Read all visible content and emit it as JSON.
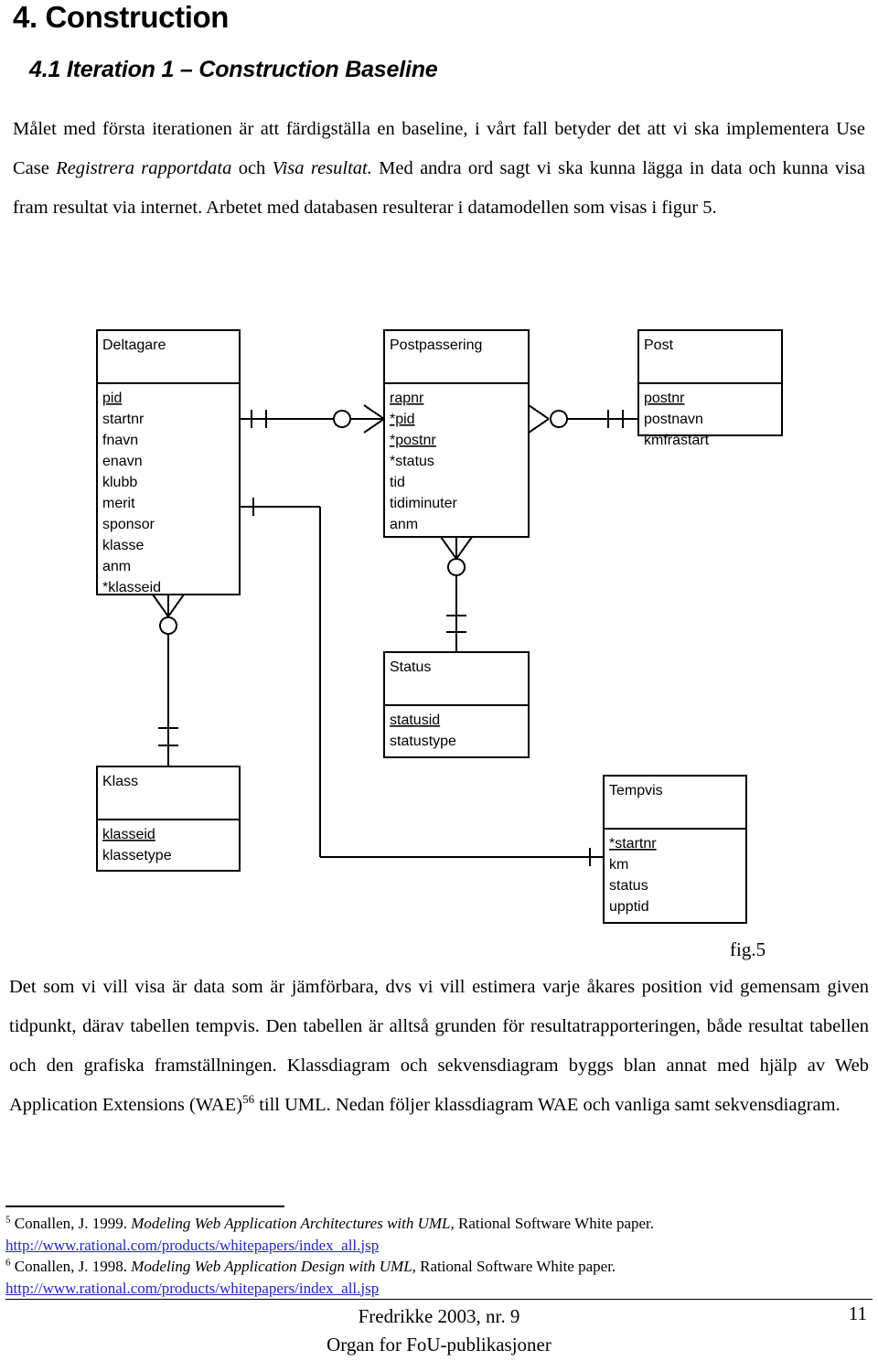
{
  "document": {
    "heading1": "4. Construction",
    "heading2": "4.1 Iteration 1 – Construction Baseline",
    "intro_paragraph": {
      "seg1": "Målet med första iterationen är att färdigställa en baseline, i vårt fall betyder det att vi ska implementera Use Case ",
      "em1": "Registrera rapportdata",
      "seg2": " och ",
      "em2": "Visa resultat.",
      "seg3": " Med andra ord sagt vi ska kunna lägga in data och kunna visa fram resultat via internet. Arbetet med databasen resulterar i  datamodellen som visas i figur 5."
    },
    "figure_caption": "fig.5",
    "body_paragraph": {
      "seg1": "Det som vi vill visa är data som är jämförbara, dvs vi vill estimera varje åkares position vid gemensam given tidpunkt, därav tabellen tempvis. Den tabellen är alltså grunden för resultatrapporteringen, både resultat tabellen och den grafiska framställningen.  Klassdiagram och sekvensdiagram byggs blan annat med hjälp av Web Application Extensions (WAE)",
      "footnote_refs": "56",
      "seg2": " till UML. Nedan följer klassdiagram WAE och vanliga samt sekvensdiagram."
    },
    "footnotes": [
      {
        "marker": "5",
        "seg1": " Conallen, J. 1999. ",
        "em": "Modeling Web Application Architectures  with UML,",
        "seg2": "  Rational Software White paper.",
        "url": "http://www.rational.com/products/whitepapers/index_all.jsp"
      },
      {
        "marker": "6",
        "seg1": " Conallen, J. 1998. ",
        "em": "Modeling Web Application Design with UML,",
        "seg2": "  Rational Software White paper.",
        "url": "http://www.rational.com/products/whitepapers/index_all.jsp"
      }
    ],
    "footer": {
      "line1": "Fredrikke 2003, nr. 9",
      "line2": "Organ for FoU-publikasjoner",
      "page_number": "11"
    },
    "link_color": "#2424c8"
  },
  "chart_data": {
    "type": "diagram",
    "diagram_kind": "entity-relationship",
    "title": "fig.5",
    "notation": "crows-foot",
    "entities": [
      {
        "id": "deltagare",
        "name": "Deltagare",
        "attributes": [
          {
            "name": "pid",
            "key": "primary"
          },
          {
            "name": "startnr",
            "key": "none"
          },
          {
            "name": "fnavn",
            "key": "none"
          },
          {
            "name": "enavn",
            "key": "none"
          },
          {
            "name": "klubb",
            "key": "none"
          },
          {
            "name": "merit",
            "key": "none"
          },
          {
            "name": "sponsor",
            "key": "none"
          },
          {
            "name": "klasse",
            "key": "none"
          },
          {
            "name": "anm",
            "key": "none"
          },
          {
            "name": "*klasseid",
            "key": "foreign"
          }
        ]
      },
      {
        "id": "postpassering",
        "name": "Postpassering",
        "attributes": [
          {
            "name": "rapnr",
            "key": "primary"
          },
          {
            "name": "*pid",
            "key": "primary-foreign"
          },
          {
            "name": "*postnr",
            "key": "primary-foreign"
          },
          {
            "name": "*status",
            "key": "foreign"
          },
          {
            "name": "tid",
            "key": "none"
          },
          {
            "name": "tidiminuter",
            "key": "none"
          },
          {
            "name": "anm",
            "key": "none"
          }
        ]
      },
      {
        "id": "post",
        "name": "Post",
        "attributes": [
          {
            "name": "postnr",
            "key": "primary"
          },
          {
            "name": "postnavn",
            "key": "none"
          },
          {
            "name": "kmfrastart",
            "key": "none"
          }
        ]
      },
      {
        "id": "status",
        "name": "Status",
        "attributes": [
          {
            "name": "statusid",
            "key": "primary"
          },
          {
            "name": "statustype",
            "key": "none"
          }
        ]
      },
      {
        "id": "klass",
        "name": "Klass",
        "attributes": [
          {
            "name": "klasseid",
            "key": "primary"
          },
          {
            "name": "klassetype",
            "key": "none"
          }
        ]
      },
      {
        "id": "tempvis",
        "name": "Tempvis",
        "attributes": [
          {
            "name": "*startnr",
            "key": "primary-foreign"
          },
          {
            "name": "km",
            "key": "none"
          },
          {
            "name": "status",
            "key": "none"
          },
          {
            "name": "upptid",
            "key": "none"
          }
        ]
      }
    ],
    "relationships": [
      {
        "from": "deltagare",
        "to": "postpassering",
        "from_cardinality": "one-and-only-one",
        "to_cardinality": "zero-or-many"
      },
      {
        "from": "postpassering",
        "to": "post",
        "from_cardinality": "zero-or-many",
        "to_cardinality": "one-and-only-one"
      },
      {
        "from": "postpassering",
        "to": "status",
        "from_cardinality": "zero-or-many",
        "to_cardinality": "one-and-only-one"
      },
      {
        "from": "deltagare",
        "to": "klass",
        "from_cardinality": "zero-or-many",
        "to_cardinality": "one-and-only-one"
      },
      {
        "from": "deltagare",
        "to": "tempvis",
        "from_cardinality": "one",
        "to_cardinality": "one"
      }
    ]
  }
}
